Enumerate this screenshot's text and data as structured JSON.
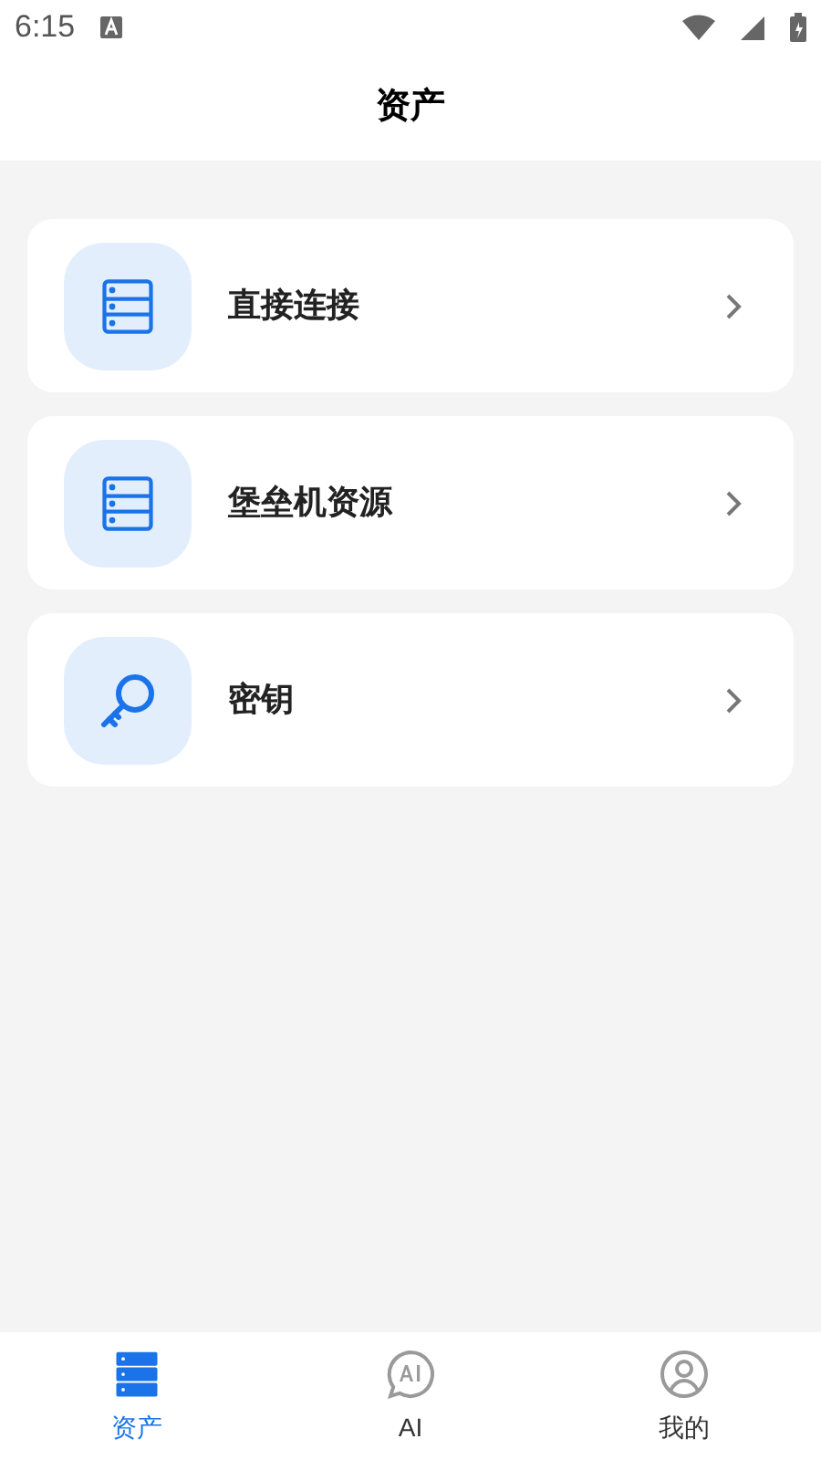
{
  "status_bar": {
    "time": "6:15"
  },
  "header": {
    "title": "资产"
  },
  "items": [
    {
      "kind": "server",
      "label": "直接连接"
    },
    {
      "kind": "server",
      "label": "堡垒机资源"
    },
    {
      "kind": "key",
      "label": "密钥"
    }
  ],
  "tabs": [
    {
      "kind": "assets",
      "label": "资产",
      "selected": true
    },
    {
      "kind": "ai",
      "label": "AI",
      "selected": false
    },
    {
      "kind": "user",
      "label": "我的",
      "selected": false
    }
  ]
}
